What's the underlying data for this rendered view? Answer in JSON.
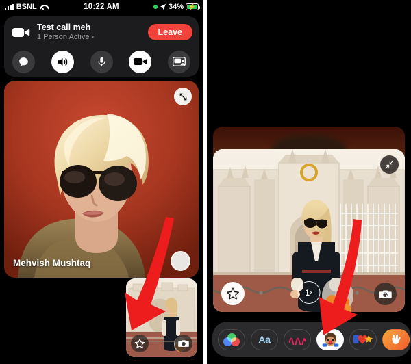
{
  "status_bar": {
    "carrier": "BSNL",
    "time": "10:22 AM",
    "battery_percent": "34%",
    "wifi_icon": "wifi-icon",
    "signal_icon": "signal-bars-icon",
    "location_icon": "location-arrow-icon",
    "recording_dot": "green-status-dot",
    "battery_icon": "battery-charging-icon",
    "accent_green": "#2fd158"
  },
  "call_card": {
    "video_icon": "video-camera-icon",
    "title": "Test call meh",
    "subtitle": "1 Person Active",
    "subtitle_chevron": "›",
    "leave_label": "Leave",
    "leave_color": "#f2433b",
    "controls": [
      {
        "name": "chat-button",
        "icon": "chat-bubble-icon",
        "active": false
      },
      {
        "name": "speaker-button",
        "icon": "speaker-wave-icon",
        "active": true
      },
      {
        "name": "microphone-button",
        "icon": "microphone-icon",
        "active": false
      },
      {
        "name": "video-button",
        "icon": "video-camera-icon",
        "active": true
      },
      {
        "name": "share-screen-button",
        "icon": "share-screen-icon",
        "active": false
      }
    ]
  },
  "remote_video": {
    "participant_name": "Mehvish Mushtaq",
    "expand_icon": "expand-arrows-icon",
    "shutter_icon": "round-capture-button",
    "background_color": "#a2351f"
  },
  "pip": {
    "effects_icon": "star-effects-icon",
    "flip_camera_icon": "flip-camera-icon"
  },
  "selfie_view": {
    "collapse_icon": "collapse-arrows-icon",
    "zoom_level": "1",
    "zoom_suffix": "x",
    "effects_icon": "star-effects-icon",
    "flip_camera_icon": "flip-camera-icon"
  },
  "effects_bar": {
    "items": [
      {
        "name": "filters-effect",
        "icon": "rgb-circles-icon",
        "label": "",
        "selected": false
      },
      {
        "name": "text-effect",
        "icon": "text-aa-icon",
        "label": "Aa",
        "selected": false
      },
      {
        "name": "shapes-effect",
        "icon": "squiggle-icon",
        "label": "∿∿",
        "selected": false
      },
      {
        "name": "memoji-effect",
        "icon": "memoji-icon",
        "label": "🧑",
        "selected": true
      },
      {
        "name": "stickers-effect",
        "icon": "sticker-pack-icon",
        "label": "❤️⭐",
        "selected": false
      },
      {
        "name": "gestures-effect",
        "icon": "hand-gesture-icon",
        "label": "✌️",
        "selected": false
      },
      {
        "name": "more-effects",
        "icon": "more-effects-icon",
        "label": "",
        "selected": false
      }
    ]
  },
  "annotations": {
    "arrow_color": "#ee1d1d",
    "left_arrow_target": "star-effects-icon on picture-in-picture",
    "right_arrow_target": "memoji-effect in effects bar"
  }
}
